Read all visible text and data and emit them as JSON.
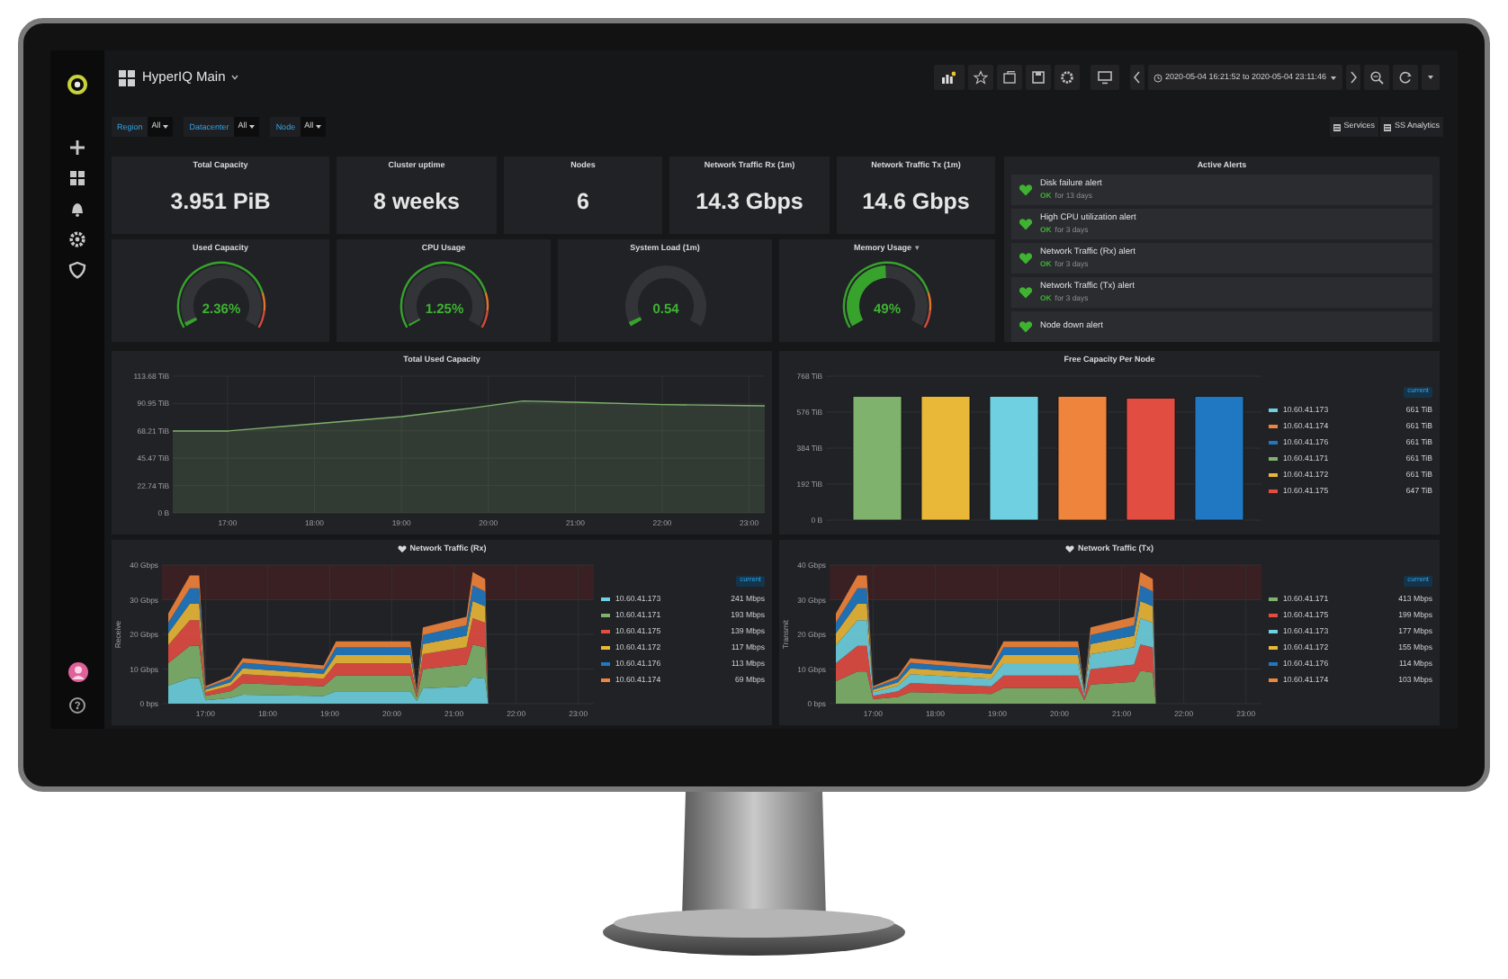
{
  "dashboard": {
    "title": "HyperIQ Main"
  },
  "time_range": "2020-05-04 16:21:52 to 2020-05-04 23:11:46",
  "variables": [
    {
      "label": "Region",
      "value": "All"
    },
    {
      "label": "Datacenter",
      "value": "All"
    },
    {
      "label": "Node",
      "value": "All"
    }
  ],
  "links": [
    "Services",
    "SS Analytics"
  ],
  "stats": [
    {
      "title": "Total Capacity",
      "value": "3.951 PiB"
    },
    {
      "title": "Cluster uptime",
      "value": "8 weeks"
    },
    {
      "title": "Nodes",
      "value": "6"
    },
    {
      "title": "Network Traffic Rx (1m)",
      "value": "14.3 Gbps"
    },
    {
      "title": "Network Traffic Tx (1m)",
      "value": "14.6 Gbps"
    }
  ],
  "gauges": [
    {
      "title": "Used Capacity",
      "value": "2.36%",
      "threshold_band": true
    },
    {
      "title": "CPU Usage",
      "value": "1.25%",
      "threshold_band": true
    },
    {
      "title": "System Load  (1m)",
      "value": "0.54",
      "threshold_band": false
    },
    {
      "title": "Memory Usage",
      "caret": "▾",
      "value": "49%",
      "threshold_band": true
    }
  ],
  "alerts_panel": {
    "title": "Active Alerts",
    "alerts": [
      {
        "name": "Disk failure alert",
        "state": "OK",
        "since": "for 13 days"
      },
      {
        "name": "High CPU utilization alert",
        "state": "OK",
        "since": "for 3 days"
      },
      {
        "name": "Network Traffic (Rx) alert",
        "state": "OK",
        "since": "for 3 days"
      },
      {
        "name": "Network Traffic (Tx) alert",
        "state": "OK",
        "since": "for 3 days"
      },
      {
        "name": "Node down alert"
      }
    ]
  },
  "used_capacity_panel": {
    "title": "Total Used Capacity",
    "chart_data": {
      "type": "area",
      "grid": true,
      "x": [
        16.37,
        17,
        18,
        19,
        19.8,
        20.4,
        21,
        22,
        23.18
      ],
      "series": [
        {
          "color": "#7eb26d",
          "values": [
            68,
            68,
            74,
            80,
            87,
            93,
            92,
            90,
            89
          ]
        }
      ],
      "xlim": [
        16.37,
        23.18
      ],
      "ylim": [
        0,
        113.68
      ],
      "xticks": [
        {
          "value": 17,
          "label": "17:00"
        },
        {
          "value": 18,
          "label": "18:00"
        },
        {
          "value": 19,
          "label": "19:00"
        },
        {
          "value": 20,
          "label": "20:00"
        },
        {
          "value": 21,
          "label": "21:00"
        },
        {
          "value": 22,
          "label": "22:00"
        },
        {
          "value": 23,
          "label": "23:00"
        }
      ],
      "yticks": [
        {
          "value": 0,
          "label": "0 B"
        },
        {
          "value": 22.74,
          "label": "22.74 TiB"
        },
        {
          "value": 45.47,
          "label": "45.47 TiB"
        },
        {
          "value": 68.21,
          "label": "68.21 TiB"
        },
        {
          "value": 90.95,
          "label": "90.95 TiB"
        },
        {
          "value": 113.68,
          "label": "113.68 TiB"
        }
      ]
    }
  },
  "free_capacity_panel": {
    "title": "Free Capacity Per Node",
    "legend_header": "current",
    "legend": [
      {
        "name": "10.60.41.173",
        "color": "#6ed0e0",
        "value": "661 TiB"
      },
      {
        "name": "10.60.41.174",
        "color": "#ef843c",
        "value": "661 TiB"
      },
      {
        "name": "10.60.41.176",
        "color": "#1f78c1",
        "value": "661 TiB"
      },
      {
        "name": "10.60.41.171",
        "color": "#7eb26d",
        "value": "661 TiB"
      },
      {
        "name": "10.60.41.172",
        "color": "#eab839",
        "value": "661 TiB"
      },
      {
        "name": "10.60.41.175",
        "color": "#e24d42",
        "value": "647 TiB"
      }
    ],
    "chart_data": {
      "type": "bar",
      "grid": true,
      "ylim": [
        0,
        768
      ],
      "yticks": [
        {
          "value": 0,
          "label": "0 B"
        },
        {
          "value": 192,
          "label": "192 TiB"
        },
        {
          "value": 384,
          "label": "384 TiB"
        },
        {
          "value": 576,
          "label": "576 TiB"
        },
        {
          "value": 768,
          "label": "768 TiB"
        }
      ],
      "series": [
        {
          "color": "#7eb26d",
          "values": [
            660
          ]
        },
        {
          "color": "#eab839",
          "values": [
            660
          ]
        },
        {
          "color": "#6ed0e0",
          "values": [
            660
          ]
        },
        {
          "color": "#ef843c",
          "values": [
            660
          ]
        },
        {
          "color": "#e24d42",
          "values": [
            650
          ]
        },
        {
          "color": "#1f78c1",
          "values": [
            660
          ]
        }
      ]
    }
  },
  "network_panels": [
    {
      "title": "Network Traffic (Rx)",
      "legend_header": "current",
      "legend": [
        {
          "name": "10.60.41.173",
          "color": "#6ed0e0",
          "value": "241 Mbps"
        },
        {
          "name": "10.60.41.171",
          "color": "#7eb26d",
          "value": "193 Mbps"
        },
        {
          "name": "10.60.41.175",
          "color": "#e24d42",
          "value": "139 Mbps"
        },
        {
          "name": "10.60.41.172",
          "color": "#eab839",
          "value": "117 Mbps"
        },
        {
          "name": "10.60.41.176",
          "color": "#1f78c1",
          "value": "113 Mbps"
        },
        {
          "name": "10.60.41.174",
          "color": "#ef843c",
          "value": "69 Mbps"
        }
      ],
      "chart_data": {
        "type": "area",
        "stacked": true,
        "grid": true,
        "ylabel": "Receive",
        "x": [
          16.4,
          16.75,
          16.9,
          17.0,
          17.4,
          17.6,
          18.9,
          19.1,
          20.3,
          20.4,
          20.5,
          21.2,
          21.3,
          21.5,
          21.55
        ],
        "xlim": [
          16.3,
          23.25
        ],
        "ylim": [
          0,
          40
        ],
        "xticks": [
          {
            "value": 17,
            "label": "17:00"
          },
          {
            "value": 18,
            "label": "18:00"
          },
          {
            "value": 19,
            "label": "19:00"
          },
          {
            "value": 20,
            "label": "20:00"
          },
          {
            "value": 21,
            "label": "21:00"
          },
          {
            "value": 22,
            "label": "22:00"
          },
          {
            "value": 23,
            "label": "23:00"
          }
        ],
        "yticks": [
          {
            "value": 0,
            "label": "0 bps"
          },
          {
            "value": 10,
            "label": "10 Gbps"
          },
          {
            "value": 20,
            "label": "20 Gbps"
          },
          {
            "value": 30,
            "label": "30 Gbps"
          },
          {
            "value": 40,
            "label": "40 Gbps"
          }
        ],
        "series": [
          {
            "color": "#6ed0e0",
            "values": [
              5.2,
              7.4,
              7.4,
              1,
              1.6,
              2.6,
              2.2,
              3.6,
              3.6,
              0.8,
              4.4,
              5,
              7.6,
              7.2,
              0
            ]
          },
          {
            "color": "#7eb26d",
            "values": [
              6.5,
              9.3,
              9.3,
              1.3,
              2,
              3.3,
              2.8,
              4.5,
              4.5,
              1,
              5.5,
              6.3,
              9.5,
              9,
              0
            ]
          },
          {
            "color": "#e24d42",
            "values": [
              5.2,
              7.4,
              7.4,
              1,
              1.6,
              2.6,
              2.2,
              3.6,
              3.6,
              0.8,
              4.4,
              5,
              7.6,
              7.2,
              0
            ]
          },
          {
            "color": "#eab839",
            "values": [
              3.4,
              4.8,
              4.8,
              0.7,
              1,
              1.7,
              1.4,
              2.3,
              2.3,
              0.5,
              2.9,
              3.3,
              4.9,
              4.7,
              0
            ]
          },
          {
            "color": "#1f78c1",
            "values": [
              3.1,
              4.4,
              4.4,
              0.6,
              1,
              1.6,
              1.3,
              2.2,
              2.2,
              0.5,
              2.6,
              3,
              4.6,
              4.3,
              0
            ]
          },
          {
            "color": "#ef843c",
            "values": [
              2.6,
              3.7,
              3.7,
              0.5,
              0.8,
              1.3,
              1.1,
              1.8,
              1.8,
              0.4,
              2.2,
              2.5,
              3.8,
              3.6,
              0
            ]
          }
        ]
      }
    },
    {
      "title": "Network Traffic (Tx)",
      "legend_header": "current",
      "legend": [
        {
          "name": "10.60.41.171",
          "color": "#7eb26d",
          "value": "413 Mbps"
        },
        {
          "name": "10.60.41.175",
          "color": "#e24d42",
          "value": "199 Mbps"
        },
        {
          "name": "10.60.41.173",
          "color": "#6ed0e0",
          "value": "177 Mbps"
        },
        {
          "name": "10.60.41.172",
          "color": "#eab839",
          "value": "155 Mbps"
        },
        {
          "name": "10.60.41.176",
          "color": "#1f78c1",
          "value": "114 Mbps"
        },
        {
          "name": "10.60.41.174",
          "color": "#ef843c",
          "value": "103 Mbps"
        }
      ],
      "chart_data": {
        "type": "area",
        "stacked": true,
        "grid": true,
        "ylabel": "Transmit",
        "x": [
          16.4,
          16.75,
          16.9,
          17.0,
          17.4,
          17.6,
          18.9,
          19.1,
          20.3,
          20.4,
          20.5,
          21.2,
          21.3,
          21.5,
          21.55
        ],
        "xlim": [
          16.3,
          23.25
        ],
        "ylim": [
          0,
          40
        ],
        "xticks": [
          {
            "value": 17,
            "label": "17:00"
          },
          {
            "value": 18,
            "label": "18:00"
          },
          {
            "value": 19,
            "label": "19:00"
          },
          {
            "value": 20,
            "label": "20:00"
          },
          {
            "value": 21,
            "label": "21:00"
          },
          {
            "value": 22,
            "label": "22:00"
          },
          {
            "value": 23,
            "label": "23:00"
          }
        ],
        "yticks": [
          {
            "value": 0,
            "label": "0 bps"
          },
          {
            "value": 10,
            "label": "10 Gbps"
          },
          {
            "value": 20,
            "label": "20 Gbps"
          },
          {
            "value": 30,
            "label": "30 Gbps"
          },
          {
            "value": 40,
            "label": "40 Gbps"
          }
        ],
        "series": [
          {
            "color": "#7eb26d",
            "values": [
              6.5,
              9.3,
              9.3,
              1.3,
              2,
              3.3,
              2.8,
              4.5,
              4.5,
              1,
              5.5,
              6.3,
              9.5,
              9,
              0
            ]
          },
          {
            "color": "#e24d42",
            "values": [
              5.2,
              7.4,
              7.4,
              1,
              1.6,
              2.6,
              2.2,
              3.6,
              3.6,
              0.8,
              4.4,
              5,
              7.6,
              7.2,
              0
            ]
          },
          {
            "color": "#6ed0e0",
            "values": [
              5.2,
              7.4,
              7.4,
              1,
              1.6,
              2.6,
              2.2,
              3.6,
              3.6,
              0.8,
              4.4,
              5,
              7.6,
              7.2,
              0
            ]
          },
          {
            "color": "#eab839",
            "values": [
              3.4,
              4.8,
              4.8,
              0.7,
              1,
              1.7,
              1.4,
              2.3,
              2.3,
              0.5,
              2.9,
              3.3,
              4.9,
              4.7,
              0
            ]
          },
          {
            "color": "#1f78c1",
            "values": [
              3.1,
              4.4,
              4.4,
              0.6,
              1,
              1.6,
              1.3,
              2.2,
              2.2,
              0.5,
              2.6,
              3,
              4.6,
              4.3,
              0
            ]
          },
          {
            "color": "#ef843c",
            "values": [
              2.6,
              3.7,
              3.7,
              0.5,
              0.8,
              1.3,
              1.1,
              1.8,
              1.8,
              0.4,
              2.2,
              2.5,
              3.8,
              3.6,
              0
            ]
          }
        ]
      }
    }
  ]
}
